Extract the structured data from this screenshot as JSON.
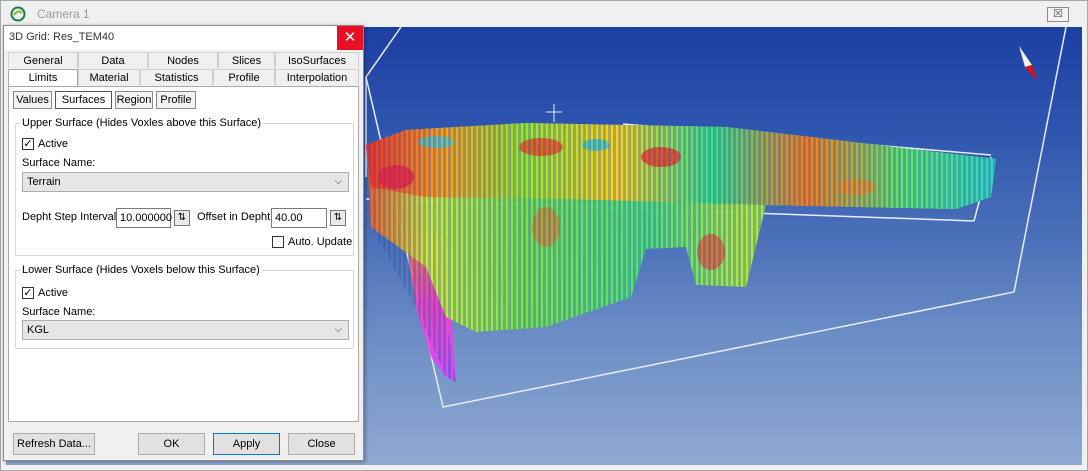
{
  "camera_window": {
    "title": "Camera 1",
    "close_symbol": "☒",
    "icons": {
      "app": "camera-app-icon",
      "north_arrow": "north-arrow-icon",
      "crosshair": "crosshair-icon"
    }
  },
  "dialog": {
    "title": "3D Grid: Res_TEM40",
    "close_symbol": "✕",
    "tabs_row1": [
      "General",
      "Data",
      "Nodes",
      "Slices",
      "IsoSurfaces"
    ],
    "tabs_row2": [
      "Limits",
      "Material",
      "Statistics",
      "Profile",
      "Interpolation"
    ],
    "active_tab": "Limits",
    "subtabs": [
      "Values",
      "Surfaces",
      "Region",
      "Profile"
    ],
    "active_subtab": "Surfaces",
    "upper": {
      "legend": "Upper Surface (Hides Voxles above this Surface)",
      "active_label": "Active",
      "active_checked": true,
      "surface_name_label": "Surface Name:",
      "surface_name_value": "Terrain",
      "step_label": "Depht Step Interval",
      "step_value": "10.000000",
      "offset_label": "Offset in Depht",
      "offset_value": "40.00",
      "auto_update_label": "Auto. Update",
      "auto_update_checked": false
    },
    "lower": {
      "legend": "Lower Surface (Hides Voxels below this Surface)",
      "active_label": "Active",
      "active_checked": true,
      "surface_name_label": "Surface Name:",
      "surface_name_value": "KGL"
    },
    "buttons": {
      "refresh": "Refresh Data...",
      "ok": "OK",
      "apply": "Apply",
      "close": "Close"
    },
    "glyphs": {
      "check": "✓",
      "dropdown": "⌵",
      "spin": "⇅"
    }
  },
  "colors": {
    "close_red": "#e81123",
    "sky_top": "#1c3fa2",
    "sky_bottom": "#8fa9d2",
    "default_button_border": "#0078d7"
  }
}
